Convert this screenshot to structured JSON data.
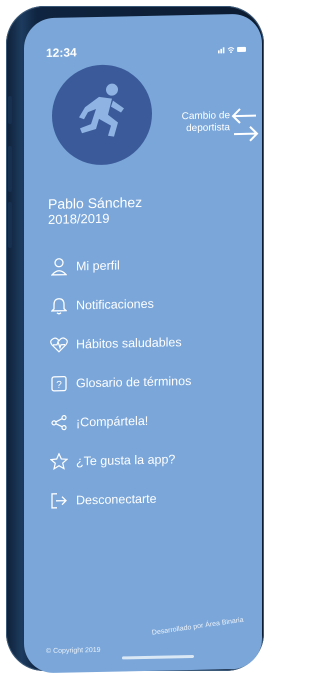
{
  "status": {
    "time": "12:34",
    "icons": "signal-wifi-battery"
  },
  "profile": {
    "avatar_icon": "runner-icon",
    "name": "Pablo Sánchez",
    "season": "2018/2019"
  },
  "switch_sport": {
    "label_line1": "Cambio de",
    "label_line2": "deportista",
    "icon": "swap-arrows-icon"
  },
  "menu": {
    "items": [
      {
        "label": "Mi perfil",
        "icon": "user-icon"
      },
      {
        "label": "Notificaciones",
        "icon": "bell-icon"
      },
      {
        "label": "Hábitos saludables",
        "icon": "heartbeat-icon"
      },
      {
        "label": "Glosario de términos",
        "icon": "question-icon"
      },
      {
        "label": "¡Compártela!",
        "icon": "share-icon"
      },
      {
        "label": "¿Te gusta la app?",
        "icon": "star-icon"
      },
      {
        "label": "Desconectarte",
        "icon": "logout-icon"
      }
    ]
  },
  "footer": {
    "copyright": "© Copyright 2019",
    "credit": "Desarrollado por Área Binaria"
  },
  "colors": {
    "screen_bg": "#7aa6d9",
    "avatar_bg": "#3b5a99",
    "text": "#ffffff"
  }
}
